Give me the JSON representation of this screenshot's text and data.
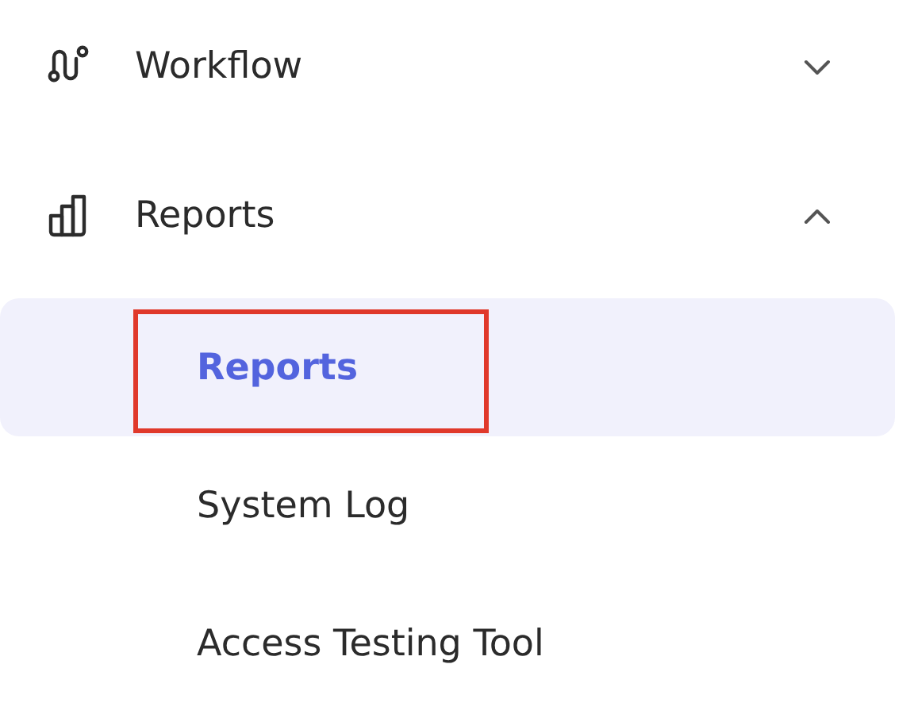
{
  "menu": [
    {
      "label": "Workflow",
      "expanded": false
    },
    {
      "label": "Reports",
      "expanded": true,
      "children": [
        {
          "label": "Reports",
          "selected": true,
          "annotated": true
        },
        {
          "label": "System Log",
          "selected": false,
          "annotated": false
        },
        {
          "label": "Access Testing Tool",
          "selected": false,
          "annotated": false
        }
      ]
    }
  ]
}
